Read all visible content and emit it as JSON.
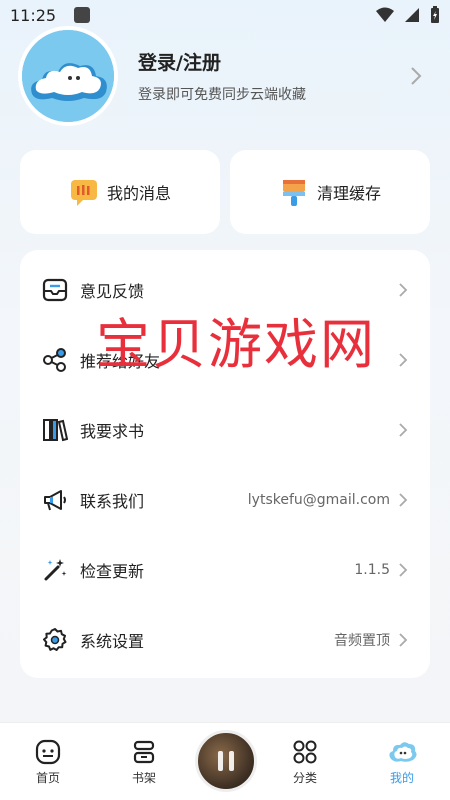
{
  "status_bar": {
    "time": "11:25"
  },
  "profile": {
    "title": "登录/注册",
    "subtitle": "登录即可免费同步云端收藏"
  },
  "quick_actions": [
    {
      "label": "我的消息",
      "icon": "message-icon"
    },
    {
      "label": "清理缓存",
      "icon": "brush-icon"
    }
  ],
  "menu": {
    "items": [
      {
        "label": "意见反馈",
        "value": "",
        "icon": "feedback-icon"
      },
      {
        "label": "推荐给好友",
        "value": "",
        "icon": "share-icon"
      },
      {
        "label": "我要求书",
        "value": "",
        "icon": "books-icon"
      },
      {
        "label": "联系我们",
        "value": "lytskefu@gmail.com",
        "icon": "megaphone-icon"
      },
      {
        "label": "检查更新",
        "value": "1.1.5",
        "icon": "magic-wand-icon"
      },
      {
        "label": "系统设置",
        "value": "音频置顶",
        "icon": "gear-icon"
      }
    ]
  },
  "watermark": "宝贝游戏网",
  "bottom_nav": {
    "items": [
      {
        "label": "首页",
        "icon": "home-icon"
      },
      {
        "label": "书架",
        "icon": "bookshelf-icon"
      },
      {
        "label": "分类",
        "icon": "category-icon"
      },
      {
        "label": "我的",
        "icon": "profile-icon",
        "active": true
      }
    ]
  },
  "colors": {
    "accent": "#3a9be6",
    "watermark": "#e8303c",
    "background": "#f4f5f7"
  }
}
